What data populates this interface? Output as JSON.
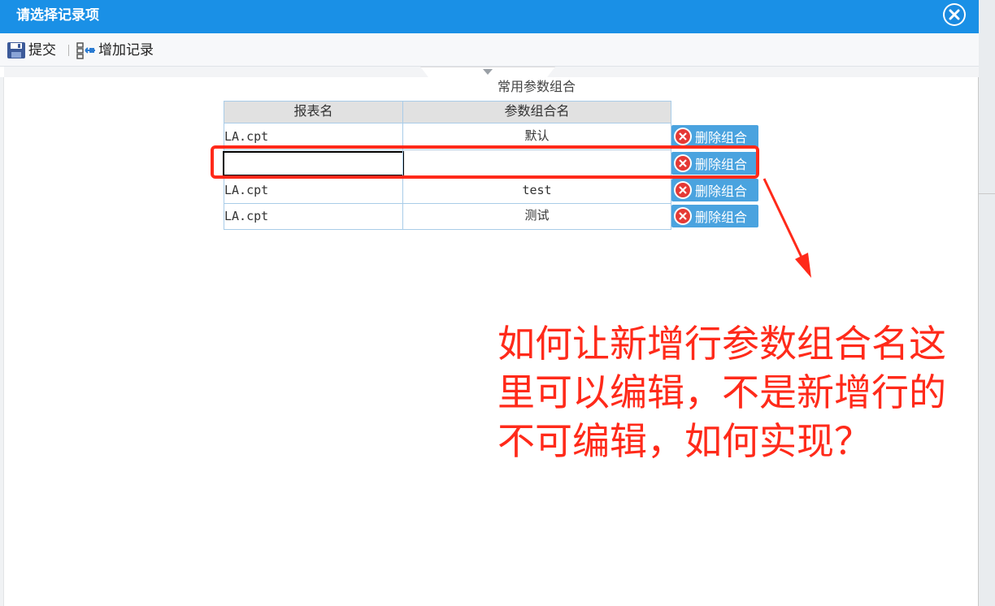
{
  "dialog": {
    "title": "请选择记录项",
    "close_icon": "close-icon"
  },
  "toolbar": {
    "submit_label": "提交",
    "submit_icon": "save-icon",
    "add_record_label": "增加记录",
    "add_record_icon": "add-record-icon"
  },
  "table": {
    "title": "常用参数组合",
    "columns": [
      "报表名",
      "参数组合名"
    ],
    "rows": [
      {
        "report": "LA.cpt",
        "combo": "默认",
        "editing": false
      },
      {
        "report": "",
        "combo": "",
        "editing": true
      },
      {
        "report": "LA.cpt",
        "combo": "test",
        "editing": false
      },
      {
        "report": "LA.cpt",
        "combo": "测试",
        "editing": false
      }
    ],
    "delete_label": "删除组合",
    "delete_icon": "delete-icon"
  },
  "annotation": {
    "text": "如何让新增行参数组合名这\n里可以编辑，不是新增行的\n不可编辑，如何实现？",
    "color": "#ff2a1a"
  },
  "colors": {
    "titlebar": "#1a90e6",
    "button": "#4aa3df",
    "annotation": "#ff2a1a"
  }
}
